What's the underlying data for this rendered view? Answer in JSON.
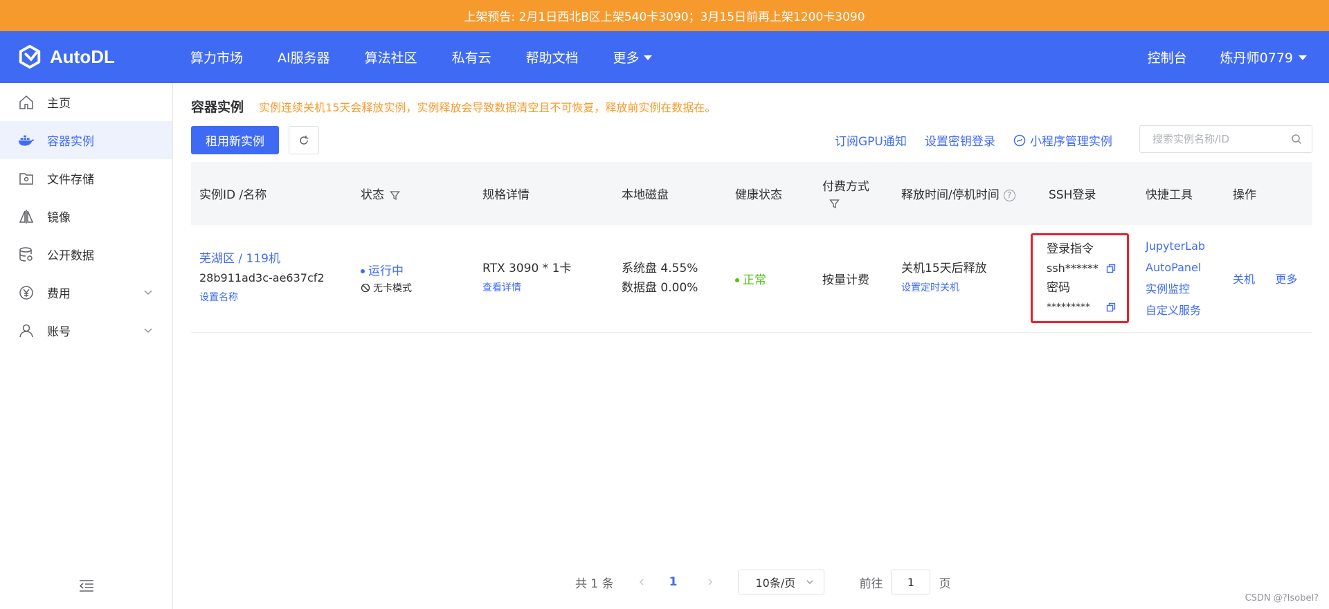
{
  "banner": {
    "text": "上架预告: 2月1日西北B区上架540卡3090；3月15日前再上架1200卡3090"
  },
  "brand": {
    "name": "AutoDL"
  },
  "nav": {
    "items": [
      "算力市场",
      "AI服务器",
      "算法社区",
      "私有云",
      "帮助文档"
    ],
    "more": "更多",
    "console": "控制台",
    "user": "炼丹师0779"
  },
  "sidebar": {
    "items": [
      {
        "label": "主页",
        "icon": "home-icon"
      },
      {
        "label": "容器实例",
        "icon": "docker-icon"
      },
      {
        "label": "文件存储",
        "icon": "storage-icon"
      },
      {
        "label": "镜像",
        "icon": "mirror-icon"
      },
      {
        "label": "公开数据",
        "icon": "database-icon"
      },
      {
        "label": "费用",
        "icon": "yuan-icon"
      },
      {
        "label": "账号",
        "icon": "user-icon"
      }
    ],
    "active": "容器实例"
  },
  "page": {
    "title": "容器实例",
    "warning": "实例连续关机15天会释放实例，实例释放会导致数据清空且不可恢复，释放前实例在数据在。",
    "new_button": "租用新实例",
    "links": [
      "订阅GPU通知",
      "设置密钥登录",
      "小程序管理实例"
    ],
    "search_placeholder": "搜索实例名称/ID"
  },
  "table": {
    "headers": {
      "id": "实例ID /名称",
      "status": "状态",
      "spec": "规格详情",
      "disk": "本地磁盘",
      "health": "健康状态",
      "billing": "付费方式",
      "release": "释放时间/停机时间",
      "ssh": "SSH登录",
      "tools": "快捷工具",
      "ops": "操作"
    },
    "row": {
      "region": "芜湖区 / 119机",
      "id": "28b911ad3c-ae637cf2",
      "set_name": "设置名称",
      "status": "运行中",
      "mode": "无卡模式",
      "gpu": "RTX 3090 * 1卡",
      "detail": "查看详情",
      "sys_disk": "系统盘 4.55%",
      "data_disk": "数据盘 0.00%",
      "health": "正常",
      "billing": "按量计费",
      "release": "关机15天后释放",
      "timer": "设置定时关机",
      "ssh_cmd_label": "登录指令",
      "ssh_cmd": "ssh******",
      "pwd_label": "密码",
      "pwd": "*********",
      "tools": [
        "JupyterLab",
        "AutoPanel",
        "实例监控",
        "自定义服务"
      ],
      "op_shutdown": "关机",
      "op_more": "更多"
    }
  },
  "pagination": {
    "total": "共 1 条",
    "current": "1",
    "page_size": "10条/页",
    "goto_prefix": "前往",
    "goto_value": "1",
    "goto_suffix": "页"
  },
  "watermark": "CSDN @?Isobel?",
  "colors": {
    "primary": "#3f6bf4",
    "banner": "#f79a2d",
    "highlight_border": "#e8222c",
    "healthy": "#52c41a"
  }
}
